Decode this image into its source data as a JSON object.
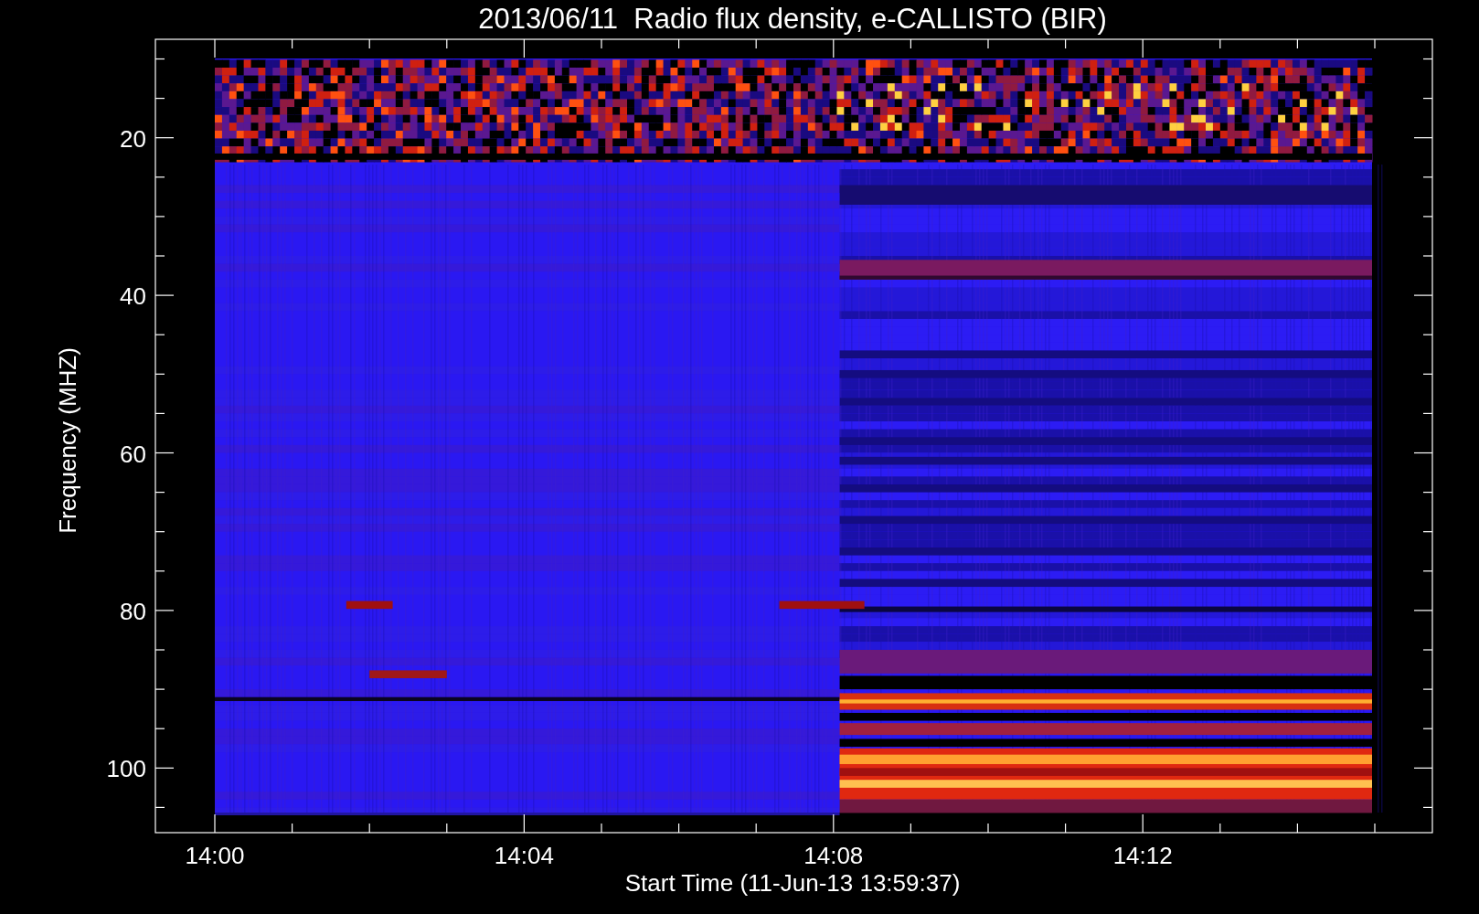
{
  "title": "2013/06/11  Radio flux density, e-CALLISTO (BIR)",
  "x_axis": {
    "label": "Start Time (11-Jun-13 13:59:37)",
    "ticks": [
      "14:00",
      "14:04",
      "14:08",
      "14:12"
    ]
  },
  "y_axis": {
    "label": "Frequency (MHZ)",
    "ticks": [
      "20",
      "40",
      "60",
      "80",
      "100"
    ]
  }
}
